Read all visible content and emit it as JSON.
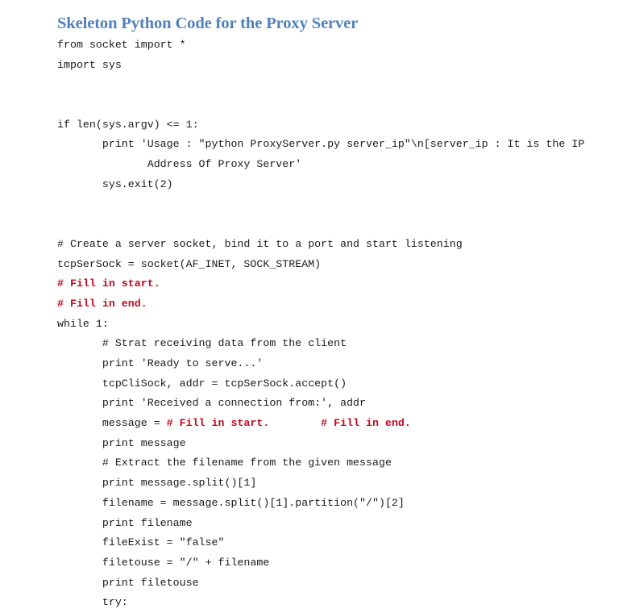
{
  "document": {
    "heading": "Skeleton Python Code for the Proxy Server",
    "heading_color": "#4f81bd",
    "code_color": "#1a1a1a",
    "fill_marker_color": "#c00a1e",
    "background_color": "#ffffff",
    "language": "python"
  },
  "code": {
    "lines": [
      {
        "id": "l01",
        "segments": [
          {
            "style": "plain",
            "text": "from socket import *"
          }
        ]
      },
      {
        "id": "l02",
        "segments": [
          {
            "style": "plain",
            "text": "import sys"
          }
        ]
      },
      {
        "id": "l03",
        "segments": [
          {
            "style": "plain",
            "text": ""
          }
        ]
      },
      {
        "id": "l04",
        "segments": [
          {
            "style": "plain",
            "text": ""
          }
        ]
      },
      {
        "id": "l05",
        "segments": [
          {
            "style": "plain",
            "text": "if len(sys.argv) <= 1:"
          }
        ]
      },
      {
        "id": "l06",
        "segments": [
          {
            "style": "plain",
            "text": "       print 'Usage : \"python ProxyServer.py server_ip\"\\n[server_ip : It is the IP"
          }
        ]
      },
      {
        "id": "l07",
        "segments": [
          {
            "style": "plain",
            "text": "              Address Of Proxy Server'"
          }
        ]
      },
      {
        "id": "l08",
        "segments": [
          {
            "style": "plain",
            "text": "       sys.exit(2)"
          }
        ]
      },
      {
        "id": "l09",
        "segments": [
          {
            "style": "plain",
            "text": ""
          }
        ]
      },
      {
        "id": "l10",
        "segments": [
          {
            "style": "plain",
            "text": ""
          }
        ]
      },
      {
        "id": "l11",
        "segments": [
          {
            "style": "plain",
            "text": "# Create a server socket, bind it to a port and start listening"
          }
        ]
      },
      {
        "id": "l12",
        "segments": [
          {
            "style": "plain",
            "text": "tcpSerSock = socket(AF_INET, SOCK_STREAM)"
          }
        ]
      },
      {
        "id": "l13",
        "segments": [
          {
            "style": "fill",
            "text": "# Fill in start."
          }
        ]
      },
      {
        "id": "l14",
        "segments": [
          {
            "style": "fill",
            "text": "# Fill in end."
          }
        ]
      },
      {
        "id": "l15",
        "segments": [
          {
            "style": "plain",
            "text": "while 1:"
          }
        ]
      },
      {
        "id": "l16",
        "segments": [
          {
            "style": "plain",
            "text": "       # Strat receiving data from the client"
          }
        ]
      },
      {
        "id": "l17",
        "segments": [
          {
            "style": "plain",
            "text": "       print 'Ready to serve...'"
          }
        ]
      },
      {
        "id": "l18",
        "segments": [
          {
            "style": "plain",
            "text": "       tcpCliSock, addr = tcpSerSock.accept()"
          }
        ]
      },
      {
        "id": "l19",
        "segments": [
          {
            "style": "plain",
            "text": "       print 'Received a connection from:', addr"
          }
        ]
      },
      {
        "id": "l20",
        "segments": [
          {
            "style": "plain",
            "text": "       message = "
          },
          {
            "style": "fill",
            "text": "# Fill in start."
          },
          {
            "style": "plain",
            "text": "        "
          },
          {
            "style": "fill",
            "text": "# Fill in end."
          }
        ]
      },
      {
        "id": "l21",
        "segments": [
          {
            "style": "plain",
            "text": "       print message"
          }
        ]
      },
      {
        "id": "l22",
        "segments": [
          {
            "style": "plain",
            "text": "       # Extract the filename from the given message"
          }
        ]
      },
      {
        "id": "l23",
        "segments": [
          {
            "style": "plain",
            "text": "       print message.split()[1]"
          }
        ]
      },
      {
        "id": "l24",
        "segments": [
          {
            "style": "plain",
            "text": "       filename = message.split()[1].partition(\"/\")[2]"
          }
        ]
      },
      {
        "id": "l25",
        "segments": [
          {
            "style": "plain",
            "text": "       print filename"
          }
        ]
      },
      {
        "id": "l26",
        "segments": [
          {
            "style": "plain",
            "text": "       fileExist = \"false\""
          }
        ]
      },
      {
        "id": "l27",
        "segments": [
          {
            "style": "plain",
            "text": "       filetouse = \"/\" + filename"
          }
        ]
      },
      {
        "id": "l28",
        "segments": [
          {
            "style": "plain",
            "text": "       print filetouse"
          }
        ]
      },
      {
        "id": "l29",
        "segments": [
          {
            "style": "plain",
            "text": "       try:"
          }
        ]
      }
    ]
  }
}
